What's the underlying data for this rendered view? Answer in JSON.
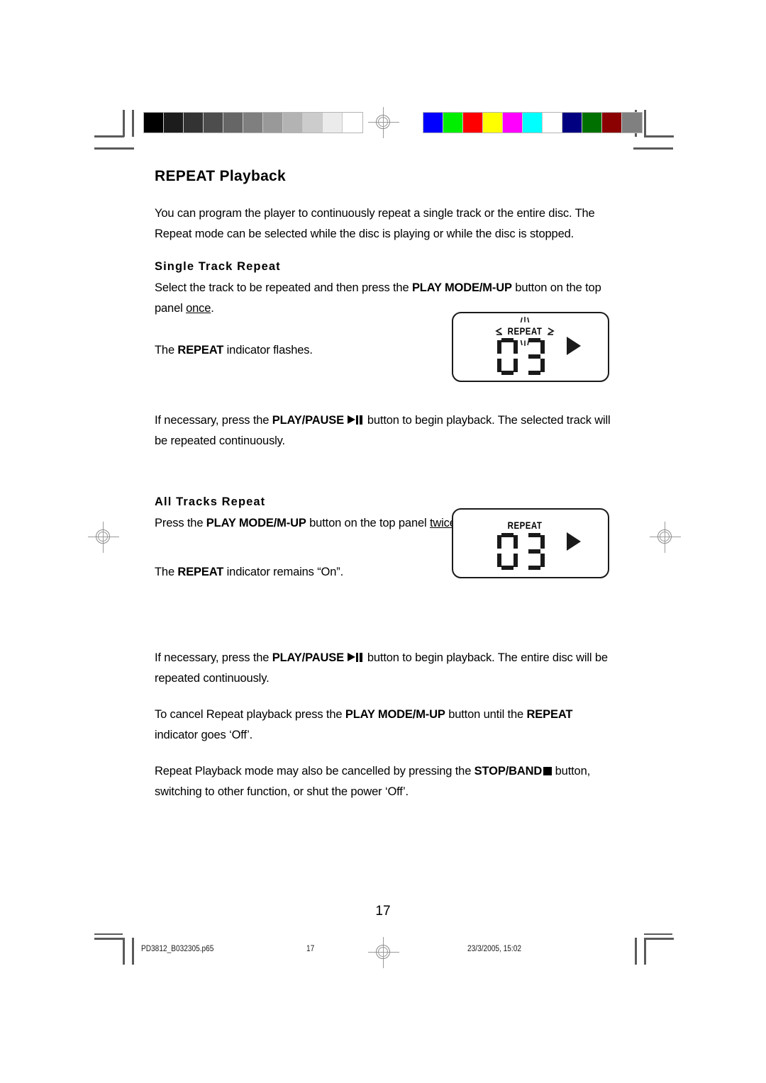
{
  "document": {
    "page_title": "REPEAT Playback",
    "page_number": "17"
  },
  "intro": {
    "line": "You can program the player to continuously repeat a single track or the entire disc. The Repeat mode can be selected while the disc is playing or while the disc is stopped."
  },
  "single_track": {
    "heading": "Single Track Repeat",
    "instruction_pre": "Select the track to be repeated and then press the ",
    "instruction_bold": "PLAY MODE/M-UP",
    "instruction_mid": " button on the top panel ",
    "instruction_underline": "once",
    "instruction_end": ".",
    "indicator_pre": "The ",
    "indicator_bold": "REPEAT",
    "indicator_post": " indicator flashes.",
    "playback_pre": "If necessary, press the ",
    "playback_bold": "PLAY/PAUSE",
    "playback_post": " button to begin playback. The selected track will be repeated continuously."
  },
  "all_tracks": {
    "heading": "All Tracks Repeat",
    "instruction_pre": "Press the ",
    "instruction_bold": "PLAY MODE/M-UP",
    "instruction_mid": " button on the top panel ",
    "instruction_underline": "twice",
    "instruction_end": ".",
    "indicator_pre": "The ",
    "indicator_bold": "REPEAT",
    "indicator_post": " indicator remains “On”.",
    "playback_pre": "If necessary, press the ",
    "playback_bold": "PLAY/PAUSE",
    "playback_post": " button to begin playback. The entire disc will be repeated continuously."
  },
  "cancel": {
    "line1_pre": "To cancel Repeat playback press the ",
    "line1_bold1": "PLAY MODE/M-UP",
    "line1_mid": " button until the ",
    "line1_bold2": "REPEAT",
    "line1_post": " indicator goes ‘Off’.",
    "line2_pre": "Repeat Playback mode may also be cancelled by pressing the ",
    "line2_bold": "STOP/BAND",
    "line2_post": " button, switching to other function, or shut the power ‘Off’."
  },
  "lcd_single": {
    "indicator_label": "REPEAT",
    "track_number": "03",
    "play_icon": "play-triangle-icon",
    "flashing": true
  },
  "lcd_all": {
    "indicator_label": "REPEAT",
    "track_number": "03",
    "play_icon": "play-triangle-icon",
    "flashing": false
  },
  "footer": {
    "filename": "PD3812_B032305.p65",
    "page": "17",
    "timestamp": "23/3/2005, 15:02"
  },
  "calibration": {
    "grayscale": [
      "#000000",
      "#1c1c1c",
      "#333333",
      "#4d4d4d",
      "#666666",
      "#7f7f7f",
      "#999999",
      "#b3b3b3",
      "#cccccc",
      "#ebebeb",
      "#ffffff"
    ],
    "colors": [
      "#0000ff",
      "#00ee00",
      "#ff0000",
      "#ffff00",
      "#ff00ff",
      "#00ffff",
      "#ffffff",
      "#000080",
      "#007000",
      "#8b0000",
      "#808080"
    ]
  }
}
